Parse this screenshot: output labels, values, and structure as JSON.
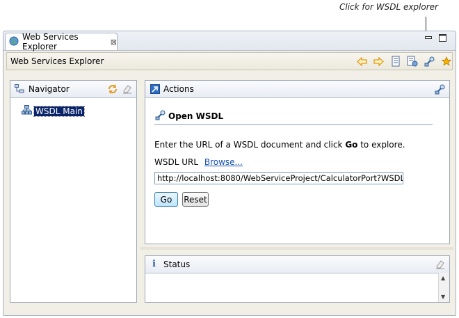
{
  "callout": {
    "text": "Click for WSDL explorer"
  },
  "tab": {
    "label": "Web Services Explorer",
    "close": "⊠"
  },
  "header": {
    "title": "Web Services Explorer"
  },
  "navigator": {
    "title": "Navigator",
    "items": [
      {
        "label": "WSDL Main",
        "selected": true
      }
    ]
  },
  "actions": {
    "title": "Actions",
    "heading": "Open WSDL",
    "instruction_prefix": "Enter the URL of a WSDL document and click ",
    "instruction_bold": "Go",
    "instruction_suffix": " to explore.",
    "url_label": "WSDL URL",
    "browse_link": "Browse...",
    "url_value": "http://localhost:8080/WebServiceProject/CalculatorPort?WSDL",
    "go_label": "Go",
    "reset_label": "Reset"
  },
  "status": {
    "title": "Status"
  },
  "colors": {
    "accent": "#0a246a",
    "link": "#1450b4",
    "star": "#f0a000",
    "arrow": "#e8a020"
  }
}
